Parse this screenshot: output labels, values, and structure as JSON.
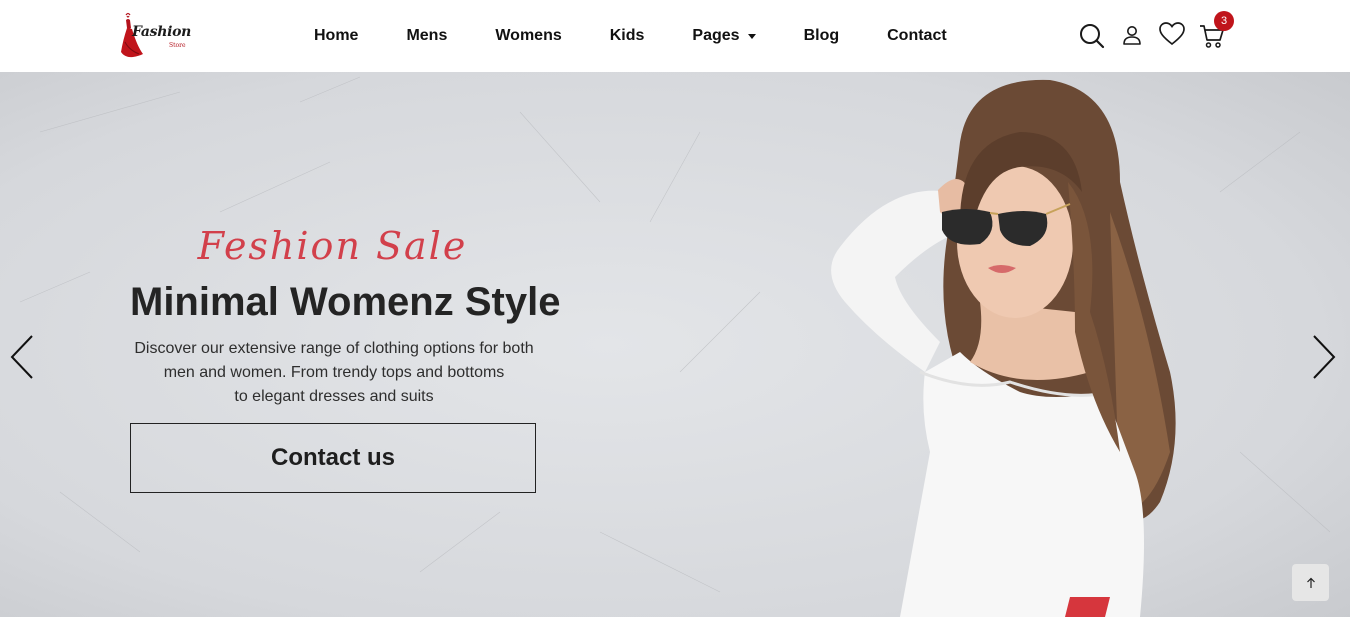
{
  "brand": {
    "name": "Fashion",
    "sub": "Store"
  },
  "nav": {
    "items": [
      {
        "label": "Home"
      },
      {
        "label": "Mens"
      },
      {
        "label": "Womens"
      },
      {
        "label": "Kids"
      },
      {
        "label": "Pages",
        "dropdown": true
      },
      {
        "label": "Blog"
      },
      {
        "label": "Contact"
      }
    ]
  },
  "header_icons": {
    "search": "search-icon",
    "account": "user-icon",
    "wishlist": "heart-icon",
    "cart": "cart-icon",
    "cart_count": "3"
  },
  "hero": {
    "script_heading": "Feshion Sale",
    "title": "Minimal Womenz Style",
    "description_lines": [
      "Discover our extensive range of clothing options for both",
      "men and women. From trendy tops and bottoms",
      "to elegant dresses and suits"
    ],
    "cta_label": "Contact us",
    "prev_icon": "chevron-left-icon",
    "next_icon": "chevron-right-icon"
  },
  "scroll_top_icon": "arrow-up-icon",
  "colors": {
    "accent": "#c0141b",
    "script": "#d2404b",
    "hero_bg": "#d9dbdf"
  }
}
